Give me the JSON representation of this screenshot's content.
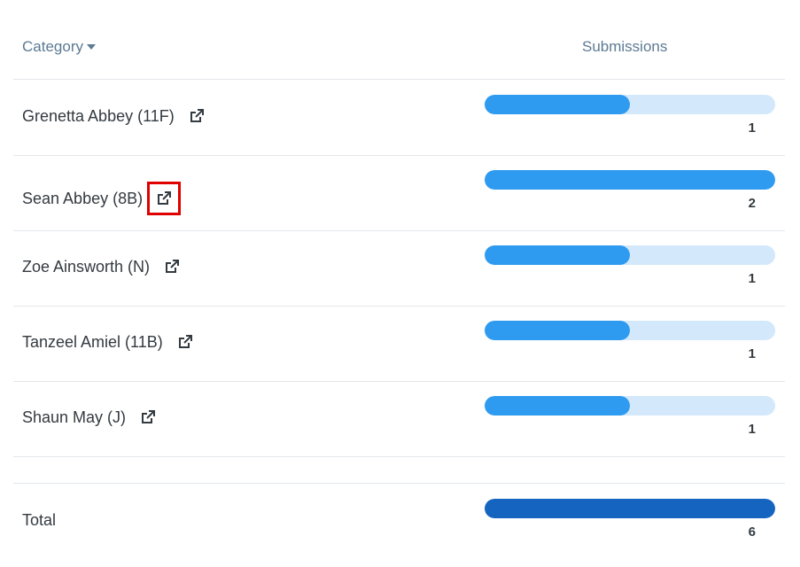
{
  "header": {
    "category_label": "Category",
    "submissions_label": "Submissions"
  },
  "rows": [
    {
      "name": "Grenetta Abbey (11F)",
      "value": "1",
      "fraction": 0.5
    },
    {
      "name": "Sean Abbey (8B)",
      "value": "2",
      "fraction": 1.0
    },
    {
      "name": "Zoe Ainsworth (N)",
      "value": "1",
      "fraction": 0.5
    },
    {
      "name": "Tanzeel Amiel (11B)",
      "value": "1",
      "fraction": 0.5
    },
    {
      "name": "Shaun May (J)",
      "value": "1",
      "fraction": 0.5
    }
  ],
  "total": {
    "label": "Total",
    "value": "6",
    "fraction": 1.0
  },
  "icons": {
    "row_link": "external-link-icon",
    "sort": "caret-down-icon"
  },
  "colors": {
    "bar_fill": "#2f9bf0",
    "bar_track": "#d3e8fb",
    "total_fill": "#1565c0",
    "highlight": "#e00000",
    "header_text": "#5c7a93"
  },
  "highlighted_row_index": 1
}
